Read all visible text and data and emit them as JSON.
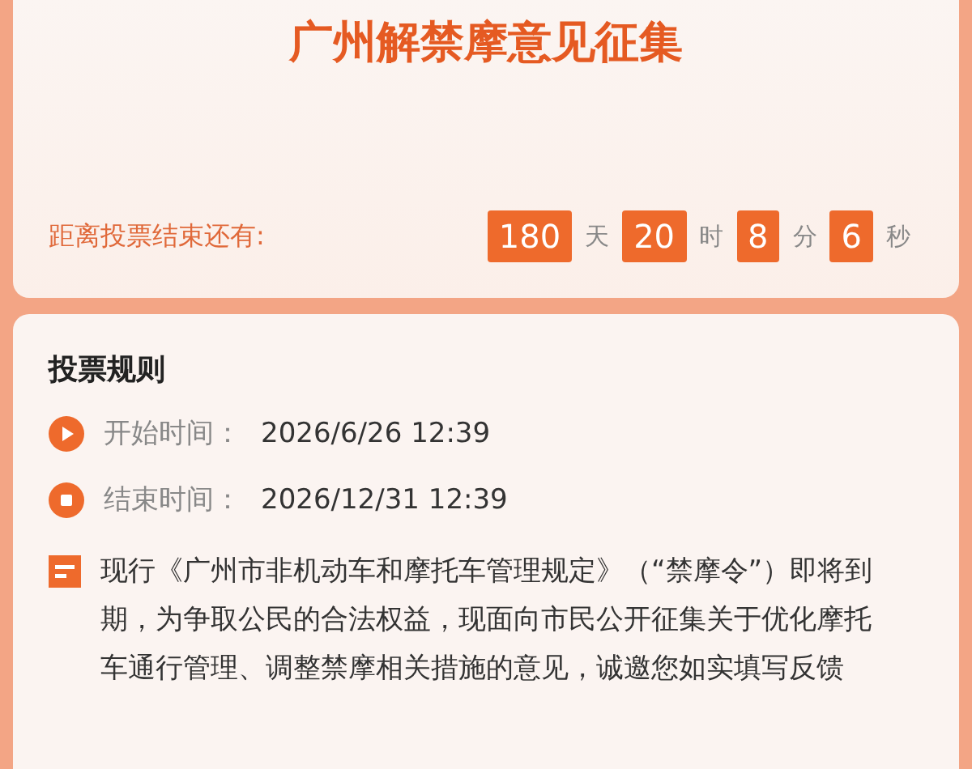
{
  "header": {
    "title": "广州解禁摩意见征集"
  },
  "countdown": {
    "label": "距离投票结束还有:",
    "parts": [
      {
        "value": "180",
        "unit": "天"
      },
      {
        "value": "20",
        "unit": "时"
      },
      {
        "value": "8",
        "unit": "分"
      },
      {
        "value": "6",
        "unit": "秒"
      }
    ]
  },
  "rules": {
    "heading": "投票规则",
    "items": [
      {
        "kind": "start",
        "label": "开始时间：",
        "value": "2026/6/26 12:39"
      },
      {
        "kind": "end",
        "label": "结束时间：",
        "value": "2026/12/31 12:39"
      },
      {
        "kind": "note",
        "text": "现行《广州市非机动车和摩托车管理规定》（“禁摩令”）即将到期，为争取公民的合法权益，现面向市民公开征集关于优化摩托车通行管理、调整禁摩相关措施的意见，诚邀您如实填写反馈"
      }
    ]
  }
}
